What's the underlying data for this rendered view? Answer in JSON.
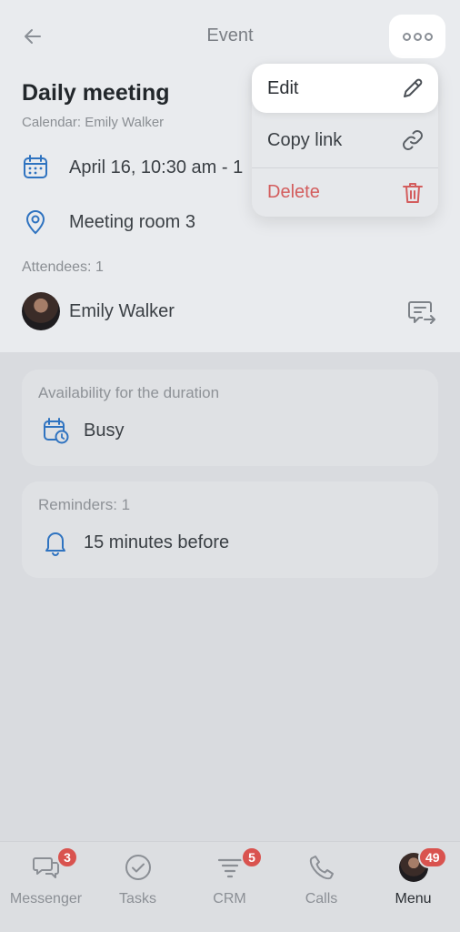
{
  "header": {
    "title": "Event"
  },
  "event": {
    "title": "Daily meeting",
    "calendar": "Calendar: Emily Walker",
    "datetime": "April 16, 10:30 am - 1",
    "location": "Meeting room 3",
    "attendees_label": "Attendees: 1",
    "attendees": [
      {
        "name": "Emily Walker"
      }
    ]
  },
  "availability": {
    "label": "Availability for the duration",
    "value": "Busy"
  },
  "reminders": {
    "label": "Reminders: 1",
    "value": "15 minutes before"
  },
  "menu": {
    "edit": "Edit",
    "copy_link": "Copy link",
    "delete": "Delete"
  },
  "tabs": [
    {
      "label": "Messenger",
      "badge": "3"
    },
    {
      "label": "Tasks"
    },
    {
      "label": "CRM",
      "badge": "5"
    },
    {
      "label": "Calls"
    },
    {
      "label": "Menu",
      "badge": "49"
    }
  ],
  "colors": {
    "accent": "#2f73c0",
    "danger": "#d35d5d",
    "badge": "#d9534f"
  },
  "icons": [
    "arrow-left-icon",
    "more-icon",
    "calendar-icon",
    "location-pin-icon",
    "chat-forward-icon",
    "calendar-clock-icon",
    "bell-icon",
    "pencil-icon",
    "link-icon",
    "trash-icon",
    "messenger-icon",
    "tasks-icon",
    "crm-icon",
    "phone-icon"
  ]
}
